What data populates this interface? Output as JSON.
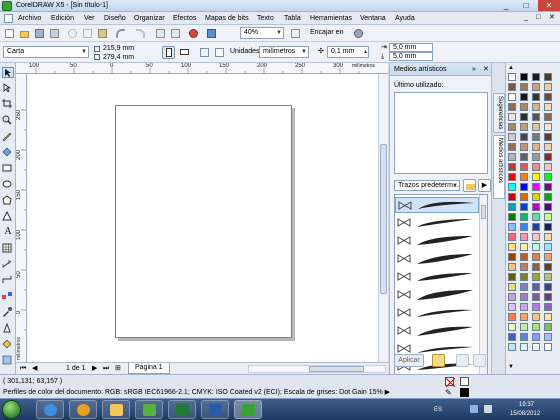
{
  "window": {
    "title": "CorelDRAW X5 - [Sin título-1]",
    "controls": [
      "_",
      "□",
      "✕"
    ]
  },
  "menu": {
    "items": [
      "Archivo",
      "Edición",
      "Ver",
      "Diseño",
      "Organizar",
      "Efectos",
      "Mapas de bits",
      "Texto",
      "Tabla",
      "Herramientas",
      "Ventana",
      "Ayuda"
    ],
    "mdi_controls": [
      "_",
      "□",
      "✕"
    ]
  },
  "toolbar": {
    "zoom_value": "40%",
    "snap_label": "Encajar en",
    "paper_preset": "Carta",
    "width_value": "215,9 mm",
    "height_value": "279,4 mm",
    "units_label": "Unidades:",
    "units_value": "milímetros",
    "nudge_value": "0,1 mm",
    "dup_x": "5,0 mm",
    "dup_y": "5,0 mm"
  },
  "rulers": {
    "h_ticks": [
      "100",
      "50",
      "0",
      "50",
      "100",
      "150",
      "200",
      "250",
      "300"
    ],
    "h_unit": "milímetros",
    "v_ticks": [
      "250",
      "200",
      "150",
      "100",
      "50",
      "0"
    ],
    "v_unit": "milímetros"
  },
  "pagenav": {
    "counter": "1 de 1",
    "page_tab": "Página 1"
  },
  "docker": {
    "title": "Medios artísticos",
    "recent_label": "Último utilizado:",
    "category": "Trazos predeterm...",
    "apply_label": "Aplicar"
  },
  "docker_tabs": [
    "Sugerencias",
    "Medios artísticos"
  ],
  "palette_colors": [
    "#ffffff",
    "#000000",
    "#1b1b1b",
    "#4d3b2a",
    "#7a5a3a",
    "#a07850",
    "#c9a27a",
    "#e8cfa8",
    "#ffffff",
    "#1a1a1a",
    "#333333",
    "#6b4a2b",
    "#8b6b4a",
    "#b08860",
    "#d6b48a",
    "#f0dcb8",
    "#e6e6e6",
    "#2e2e2e",
    "#555555",
    "#8a6a4a",
    "#a8865f",
    "#c79e70",
    "#e2c196",
    "#f7e6c8",
    "#cccccc",
    "#474747",
    "#777777",
    "#5a3d2e",
    "#9a6e4e",
    "#c6916b",
    "#e0b08a",
    "#f3d2b0",
    "#b3b3b3",
    "#606060",
    "#999999",
    "#8c2b2b",
    "#b83c3c",
    "#d95a5a",
    "#ee8c8c",
    "#f8c4c4",
    "#ff0000",
    "#ff8000",
    "#ffff00",
    "#00ff00",
    "#00ffff",
    "#0000ff",
    "#ff00ff",
    "#800080",
    "#d40000",
    "#e06a00",
    "#e0d000",
    "#00a800",
    "#00a0c0",
    "#0040d0",
    "#c000c0",
    "#5a0080",
    "#008000",
    "#00c060",
    "#60e0a0",
    "#c0ff80",
    "#80c0ff",
    "#4080ff",
    "#2040a0",
    "#102060",
    "#ff6080",
    "#ff90b0",
    "#ffc0d0",
    "#ffd8a0",
    "#ffe070",
    "#fff0a0",
    "#c0ffe0",
    "#a0e0ff",
    "#a04000",
    "#c06020",
    "#e08040",
    "#f0a060",
    "#f8c080",
    "#c08060",
    "#906040",
    "#604020",
    "#606000",
    "#808020",
    "#a0a040",
    "#c0c060",
    "#e0e080",
    "#8080c0",
    "#6060a0",
    "#404080",
    "#c0a0e0",
    "#a080c0",
    "#806090",
    "#604070",
    "#e0c0ff",
    "#d0a0f0",
    "#b080e0",
    "#9060c0",
    "#ff8040",
    "#ffa060",
    "#ffc080",
    "#ffe0a0",
    "#e0ffc0",
    "#c0f0a0",
    "#a0e080",
    "#80c060",
    "#4060c0",
    "#6080e0",
    "#80a0ff",
    "#a0c0ff",
    "#c0e0ff",
    "#e0f0ff",
    "#f0f8ff",
    "#ffffff"
  ],
  "status": {
    "coords": "( 301,131; 63,157 )",
    "color_profile": "Perfiles de color del documento: RGB: sRGB IEC61966-2.1; CMYK: ISO Coated v2 (ECI); Escala de grises: Dot Gain 15%  ▶"
  },
  "taskbar": {
    "lang": "ES",
    "time": "19:37",
    "date": "15/08/2012"
  }
}
